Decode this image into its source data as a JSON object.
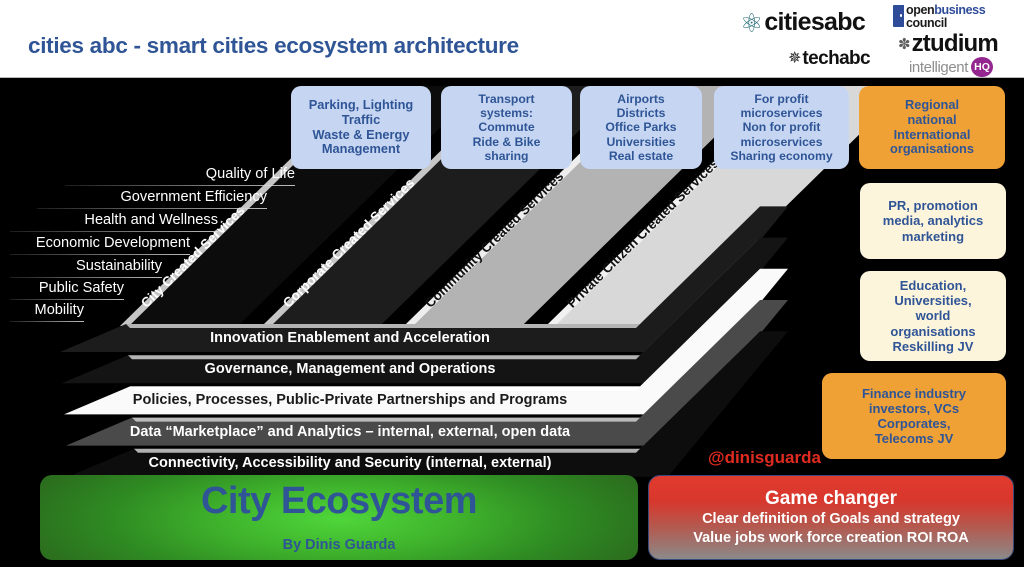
{
  "header": {
    "title": "cities abc - smart cities ecosystem architecture",
    "logos": {
      "citiesabc": "citiesabc",
      "techabc": "techabc",
      "obc_open": "open",
      "obc_business": "business",
      "obc_council": "council",
      "ztudium": "ztudium",
      "intelligent": "intelligent",
      "intelligent_badge": "HQ"
    },
    "colors": {
      "title": "#2f5596",
      "accent_blue": "#2f4c9b",
      "badge_purple": "#93278f"
    }
  },
  "top_boxes": [
    {
      "id": "parking",
      "text": "Parking, Lighting\nTraffic\nWaste & Energy\nManagement",
      "style": "blue"
    },
    {
      "id": "transport",
      "text": "Transport\nsystems:\nCommute\nRide & Bike\nsharing",
      "style": "blue"
    },
    {
      "id": "airports",
      "text": "Airports\nDistricts\nOffice Parks\nUniversities\nReal estate",
      "style": "blue"
    },
    {
      "id": "microservices",
      "text": "For profit\nmicroservices\nNon for profit\nmicroservices\nSharing economy",
      "style": "blue"
    },
    {
      "id": "organisations",
      "text": "Regional\nnational\nInternational\norganisations",
      "style": "orange"
    }
  ],
  "right_boxes": [
    {
      "id": "pr",
      "text": "PR, promotion\nmedia, analytics\nmarketing",
      "style": "cream"
    },
    {
      "id": "education",
      "text": "Education,\nUniversities,\nworld\norganisations\nReskilling JV",
      "style": "cream"
    },
    {
      "id": "finance",
      "text": "Finance industry\ninvestors, VCs\nCorporates,\nTelecoms JV",
      "style": "orange"
    }
  ],
  "axis_labels": [
    "Quality of Life",
    "Government Efficiency",
    "Health and Wellness",
    "Economic Development",
    "Sustainability",
    "Public Safety",
    "Mobility"
  ],
  "service_bands": [
    {
      "id": "city",
      "label": "City Created Services",
      "fill": "#0c0c0c",
      "text": "#ffffff"
    },
    {
      "id": "corporate",
      "label": "Corporate Created Services",
      "fill": "#1d1d1d",
      "text": "#ffffff"
    },
    {
      "id": "community",
      "label": "Community Created Services",
      "fill": "#b3b3b3",
      "text": "#111111"
    },
    {
      "id": "private",
      "label": "Private Citizen Created Services",
      "fill": "#d8d8d8",
      "text": "#111111"
    }
  ],
  "layers": [
    {
      "id": "innovation",
      "label": "Innovation Enablement and Acceleration",
      "fill": "#1c1c1c",
      "text": "#ffffff"
    },
    {
      "id": "governance",
      "label": "Governance, Management and Operations",
      "fill": "#141414",
      "text": "#ffffff"
    },
    {
      "id": "policies",
      "label": "Policies, Processes, Public-Private Partnerships and Programs",
      "fill": "#fafafa",
      "text": "#1a1a1a"
    },
    {
      "id": "data",
      "label": "Data “Marketplace” and Analytics – internal, external, open data",
      "fill": "#4a4a4a",
      "text": "#ffffff"
    },
    {
      "id": "connectivity",
      "label": "Connectivity, Accessibility and Security (internal, external)",
      "fill": "#0d0d0d",
      "text": "#ffffff"
    }
  ],
  "bottom": {
    "city": {
      "title": "City Ecosystem",
      "subtitle": "By Dinis Guarda",
      "color": "#2f5596"
    },
    "game": {
      "title": "Game changer",
      "line1": "Clear definition of Goals and strategy",
      "line2": "Value jobs work force creation ROI ROA"
    },
    "handle": "@dinisguarda"
  }
}
